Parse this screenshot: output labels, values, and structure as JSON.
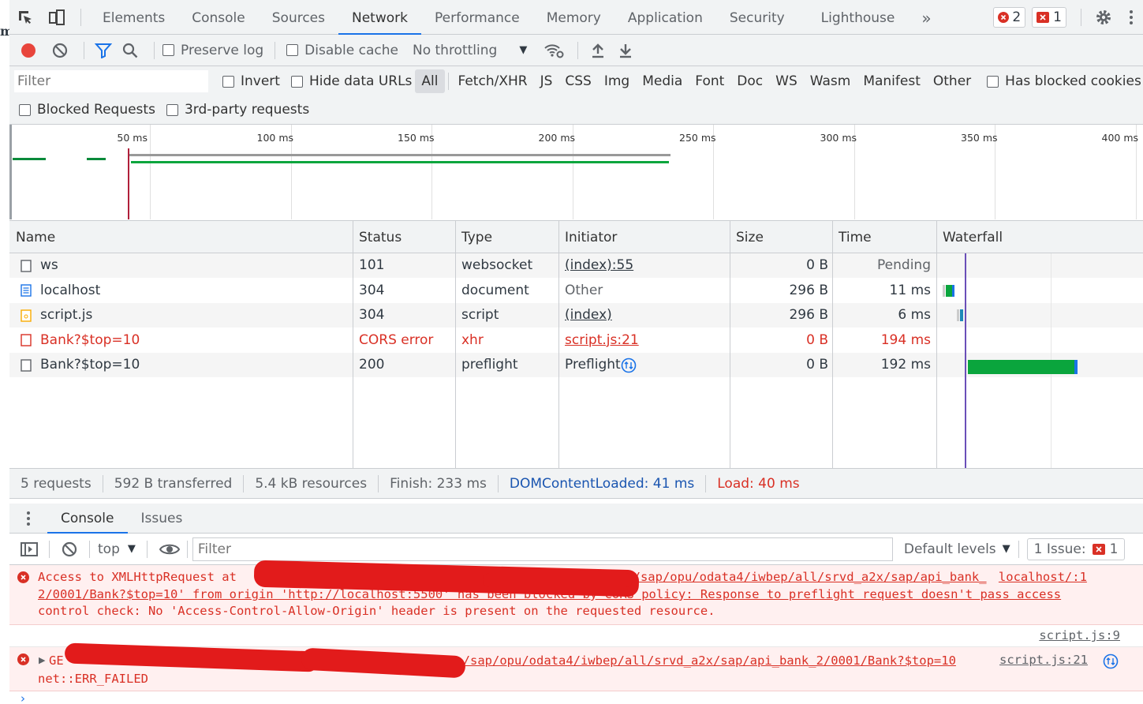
{
  "top_tabs": [
    "Elements",
    "Console",
    "Sources",
    "Network",
    "Performance",
    "Memory",
    "Application",
    "Security",
    "Lighthouse"
  ],
  "active_tab": "Network",
  "more_tabs_label": "»",
  "error_count": "2",
  "issue_count": "1",
  "toolbar": {
    "preserve_log": "Preserve log",
    "disable_cache": "Disable cache",
    "throttling": "No throttling"
  },
  "filter": {
    "placeholder": "Filter",
    "invert": "Invert",
    "hide_data_urls": "Hide data URLs",
    "types": [
      "All",
      "Fetch/XHR",
      "JS",
      "CSS",
      "Img",
      "Media",
      "Font",
      "Doc",
      "WS",
      "Wasm",
      "Manifest",
      "Other"
    ],
    "has_blocked_cookies": "Has blocked cookies",
    "blocked_requests": "Blocked Requests",
    "third_party": "3rd-party requests"
  },
  "overview": {
    "ticks": [
      "50 ms",
      "100 ms",
      "150 ms",
      "200 ms",
      "250 ms",
      "300 ms",
      "350 ms",
      "400 ms"
    ]
  },
  "table": {
    "columns": [
      "Name",
      "Status",
      "Type",
      "Initiator",
      "Size",
      "Time",
      "Waterfall"
    ],
    "rows": [
      {
        "name": "ws",
        "status": "101",
        "type": "websocket",
        "initiator": "(index):55",
        "size": "0 B",
        "time": "Pending"
      },
      {
        "name": "localhost",
        "status": "304",
        "type": "document",
        "initiator": "Other",
        "size": "296 B",
        "time": "11 ms"
      },
      {
        "name": "script.js",
        "status": "304",
        "type": "script",
        "initiator": "(index)",
        "size": "296 B",
        "time": "6 ms"
      },
      {
        "name": "Bank?$top=10",
        "status": "CORS error",
        "type": "xhr",
        "initiator": "script.js:21",
        "size": "0 B",
        "time": "194 ms"
      },
      {
        "name": "Bank?$top=10",
        "status": "200",
        "type": "preflight",
        "initiator": "Preflight",
        "size": "0 B",
        "time": "192 ms"
      }
    ]
  },
  "summary": {
    "requests": "5 requests",
    "transferred": "592 B transferred",
    "resources": "5.4 kB resources",
    "finish": "Finish: 233 ms",
    "dcl": "DOMContentLoaded: 41 ms",
    "load": "Load: 40 ms"
  },
  "drawer": {
    "tabs": [
      "Console",
      "Issues"
    ],
    "context": "top",
    "filter_placeholder": "Filter",
    "levels": "Default levels",
    "issues_label": "1 Issue:",
    "issues_count": "1"
  },
  "console": {
    "msg1_line1_pre": "Access to XMLHttpRequest at",
    "msg1_line1_post": "3/sap/opu/odata4/iwbep/all/srvd_a2x/sap/api_bank_",
    "msg1_link": "localhost/:1",
    "msg1_line2": "2/0001/Bank?$top=10' from origin 'http://localhost:5500' has been blocked by CORS policy: Response to preflight request doesn't pass access",
    "msg1_line3": "control check: No 'Access-Control-Allow-Origin' header is present on the requested resource.",
    "msg1_source": "script.js:9",
    "msg2_pre": "GE",
    "msg2_post": "/sap/opu/odata4/iwbep/all/srvd_a2x/sap/api_bank_2/0001/Bank?$top=10",
    "msg2_source": "script.js:21",
    "msg2_line2": "net::ERR_FAILED"
  }
}
